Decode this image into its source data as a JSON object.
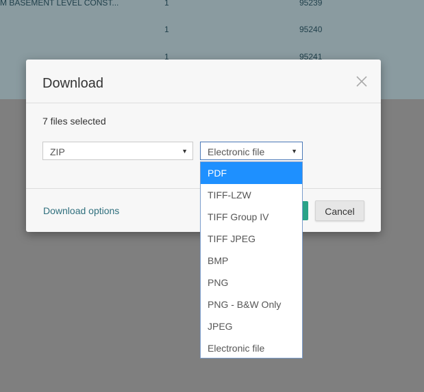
{
  "background_table": {
    "rows": [
      {
        "name": "M BASEMENT LEVEL CONST...",
        "qty": "1",
        "id": "95239"
      },
      {
        "name": "",
        "qty": "1",
        "id": "95240"
      },
      {
        "name": "",
        "qty": "1",
        "id": "95241"
      }
    ]
  },
  "dialog": {
    "title": "Download",
    "files_selected": "7 files selected",
    "archive_select": {
      "value": "ZIP"
    },
    "format_select": {
      "value": "Electronic file"
    },
    "download_options_label": "Download options",
    "cancel_label": "Cancel"
  },
  "dropdown": {
    "options": [
      "PDF",
      "TIFF-LZW",
      "TIFF Group IV",
      "TIFF JPEG",
      "BMP",
      "PNG",
      "PNG - B&W Only",
      "JPEG",
      "Electronic file"
    ],
    "highlighted": "PDF"
  },
  "colors": {
    "highlight": "#1e90ff",
    "link": "#2f6f7d",
    "primary_button": "#2aa388"
  }
}
